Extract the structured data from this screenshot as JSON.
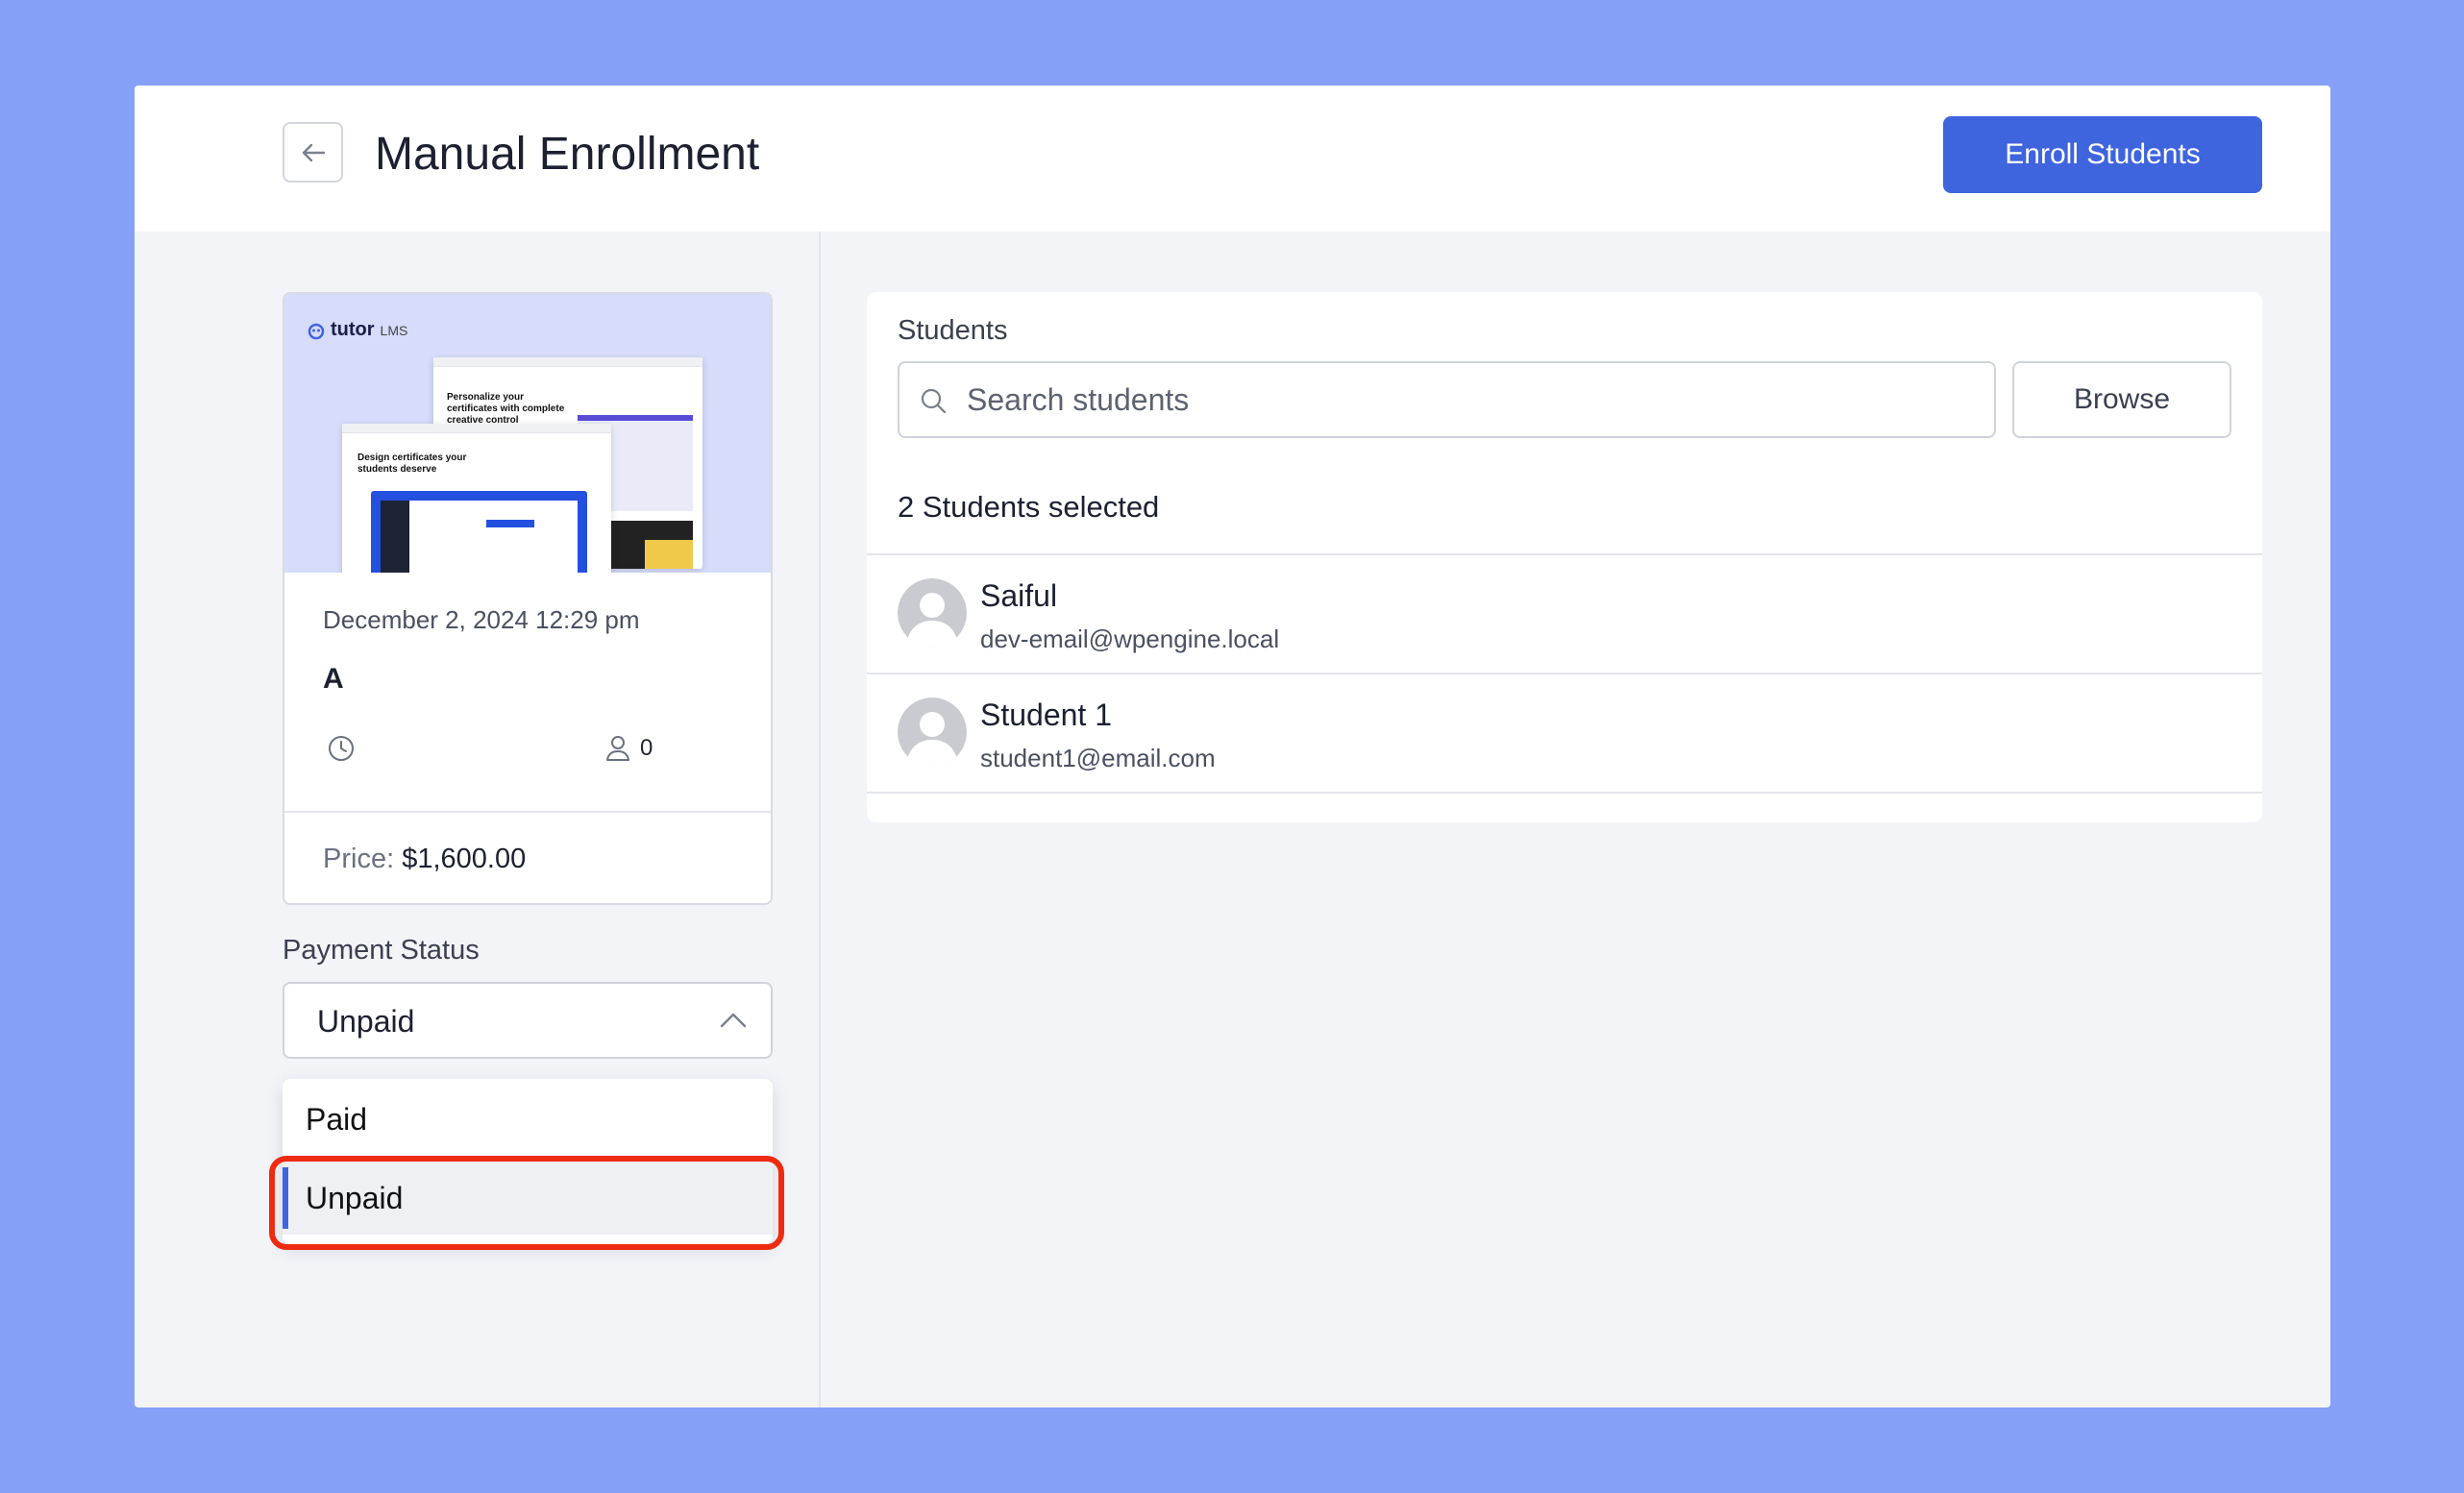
{
  "header": {
    "title": "Manual Enrollment",
    "enroll_label": "Enroll Students",
    "back_icon": "arrow-left-icon"
  },
  "course": {
    "thumbnail": {
      "logo_text": "tutor",
      "logo_suffix": "LMS",
      "headline_1": "Personalize your certificates with complete creative control",
      "headline_2": "Design certificates your students deserve"
    },
    "date": "December 2, 2024 12:29 pm",
    "name": "A",
    "enrolled_count": "0",
    "price_label": "Price:",
    "price_value": "$1,600.00"
  },
  "payment": {
    "label": "Payment Status",
    "selected": "Unpaid",
    "options": [
      "Paid",
      "Unpaid"
    ],
    "highlight_color": "#ee2b10"
  },
  "students": {
    "label": "Students",
    "search_placeholder": "Search students",
    "browse_label": "Browse",
    "selected_text": "2 Students selected",
    "list": [
      {
        "name": "Saiful",
        "email": "dev-email@wpengine.local"
      },
      {
        "name": "Student 1",
        "email": "student1@email.com"
      }
    ]
  },
  "colors": {
    "background": "#86a0f8",
    "accent": "#3e64de"
  }
}
